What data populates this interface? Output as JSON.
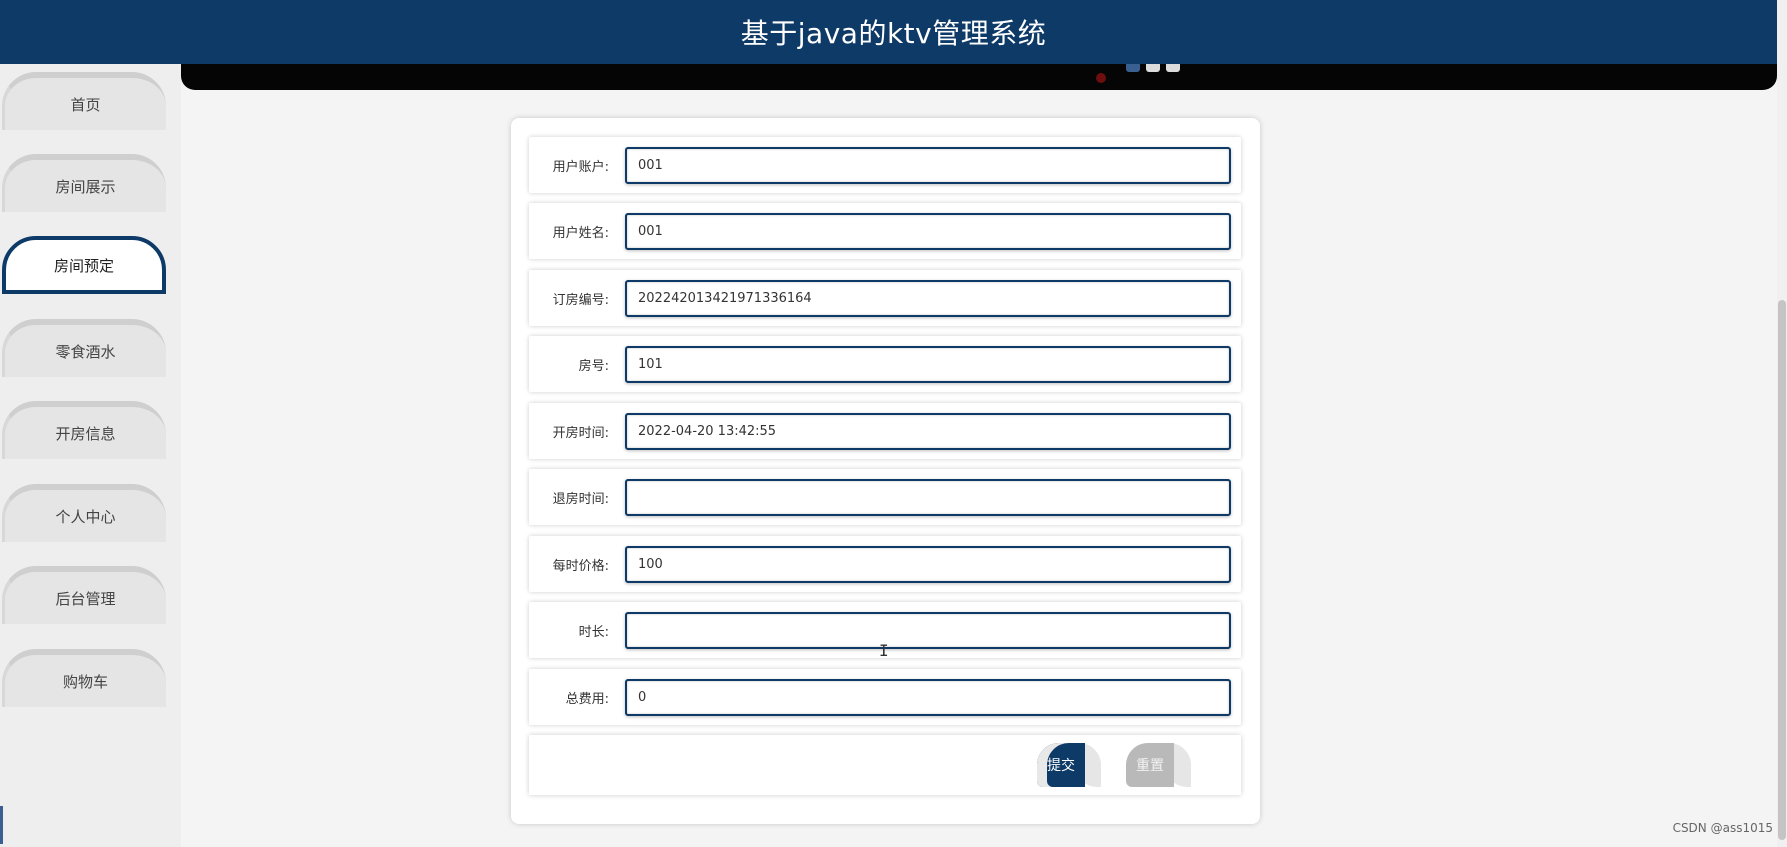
{
  "header": {
    "title": "基于java的ktv管理系统"
  },
  "sidebar": {
    "items": [
      {
        "label": "首页",
        "active": false
      },
      {
        "label": "房间展示",
        "active": false
      },
      {
        "label": "房间预定",
        "active": true
      },
      {
        "label": "零食酒水",
        "active": false
      },
      {
        "label": "开房信息",
        "active": false
      },
      {
        "label": "个人中心",
        "active": false
      },
      {
        "label": "后台管理",
        "active": false
      },
      {
        "label": "购物车",
        "active": false
      }
    ]
  },
  "form": {
    "fields": [
      {
        "label": "用户账户:",
        "value": "001"
      },
      {
        "label": "用户姓名:",
        "value": "001"
      },
      {
        "label": "订房编号:",
        "value": "20224201342197133616​4"
      },
      {
        "label": "房号:",
        "value": "101"
      },
      {
        "label": "开房时间:",
        "value": "2022-04-20 13:42:55"
      },
      {
        "label": "退房时间:",
        "value": ""
      },
      {
        "label": "每时价格:",
        "value": "100"
      },
      {
        "label": "时长:",
        "value": ""
      },
      {
        "label": "总费用:",
        "value": "0"
      }
    ],
    "submit_label": "提交",
    "reset_label": "重置"
  },
  "footer": {
    "watermark": "CSDN @ass1015"
  },
  "colors": {
    "primary": "#0e3a67",
    "reset_button": "#b9b9b9"
  }
}
